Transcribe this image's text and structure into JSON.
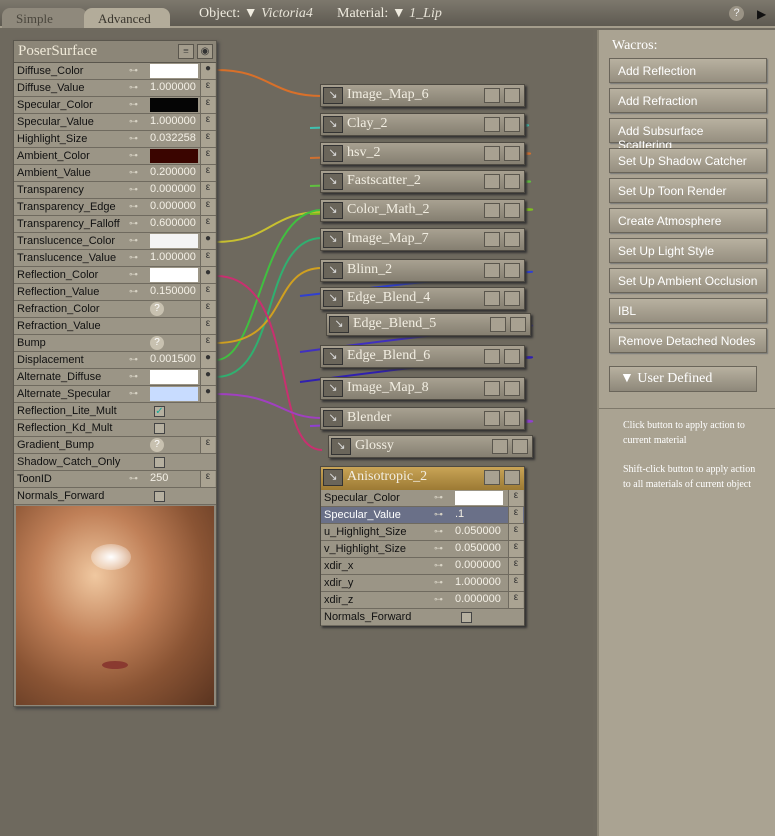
{
  "tabs": {
    "simple": "Simple",
    "advanced": "Advanced"
  },
  "object": {
    "label": "Object:",
    "value": "Victoria4"
  },
  "material": {
    "label": "Material:",
    "value": "1_Lip"
  },
  "help_icon": "?",
  "surface": {
    "title": "PoserSurface",
    "rows": [
      {
        "label": "Diffuse_Color",
        "type": "color",
        "color": "#ffffff",
        "plug": "globe"
      },
      {
        "label": "Diffuse_Value",
        "type": "value",
        "value": "1.000000"
      },
      {
        "label": "Specular_Color",
        "type": "color",
        "color": "#050505"
      },
      {
        "label": "Specular_Value",
        "type": "value",
        "value": "1.000000"
      },
      {
        "label": "Highlight_Size",
        "type": "value",
        "value": "0.032258"
      },
      {
        "label": "Ambient_Color",
        "type": "color",
        "color": "#3a0500"
      },
      {
        "label": "Ambient_Value",
        "type": "value",
        "value": "0.200000"
      },
      {
        "label": "Transparency",
        "type": "value",
        "value": "0.000000"
      },
      {
        "label": "Transparency_Edge",
        "type": "value",
        "value": "0.000000"
      },
      {
        "label": "Transparency_Falloff",
        "type": "value",
        "value": "0.600000"
      },
      {
        "label": "Translucence_Color",
        "type": "color",
        "color": "#f4f4f4",
        "plug": "globe"
      },
      {
        "label": "Translucence_Value",
        "type": "value",
        "value": "1.000000"
      },
      {
        "label": "Reflection_Color",
        "type": "color",
        "color": "#ffffff",
        "plug": "globe"
      },
      {
        "label": "Reflection_Value",
        "type": "value",
        "value": "0.150000"
      },
      {
        "label": "Refraction_Color",
        "type": "help",
        "value": "?"
      },
      {
        "label": "Refraction_Value",
        "type": "none"
      },
      {
        "label": "Bump",
        "type": "help",
        "value": "?"
      },
      {
        "label": "Displacement",
        "type": "value",
        "value": "0.001500",
        "plug": "globe"
      },
      {
        "label": "Alternate_Diffuse",
        "type": "color",
        "color": "#ffffff",
        "plug": "globe"
      },
      {
        "label": "Alternate_Specular",
        "type": "color",
        "color": "#c8dcff",
        "plug": "globe"
      },
      {
        "label": "Reflection_Lite_Mult",
        "type": "check",
        "checked": true,
        "noplug": true
      },
      {
        "label": "Reflection_Kd_Mult",
        "type": "check",
        "checked": false,
        "noplug": true
      },
      {
        "label": "Gradient_Bump",
        "type": "help",
        "value": "?"
      },
      {
        "label": "Shadow_Catch_Only",
        "type": "check",
        "checked": false,
        "noplug": true
      },
      {
        "label": "ToonID",
        "type": "value",
        "value": "250"
      },
      {
        "label": "Normals_Forward",
        "type": "check",
        "checked": false,
        "noplug": true
      }
    ]
  },
  "nodes": [
    "Image_Map_6",
    "Clay_2",
    "hsv_2",
    "Fastscatter_2",
    "Color_Math_2",
    "Image_Map_7",
    "Blinn_2",
    "Edge_Blend_4",
    "Edge_Blend_5",
    "Edge_Blend_6",
    "Image_Map_8",
    "Blender",
    "Glossy"
  ],
  "aniso": {
    "title": "Anisotropic_2",
    "rows": [
      {
        "label": "Specular_Color",
        "type": "color",
        "color": "#ffffff"
      },
      {
        "label": "Specular_Value",
        "type": "value",
        "value": ".1",
        "selected": true
      },
      {
        "label": "u_Highlight_Size",
        "type": "value",
        "value": "0.050000"
      },
      {
        "label": "v_Highlight_Size",
        "type": "value",
        "value": "0.050000"
      },
      {
        "label": "xdir_x",
        "type": "value",
        "value": "0.000000"
      },
      {
        "label": "xdir_y",
        "type": "value",
        "value": "1.000000"
      },
      {
        "label": "xdir_z",
        "type": "value",
        "value": "0.000000"
      },
      {
        "label": "Normals_Forward",
        "type": "check",
        "checked": false,
        "noplug": true
      }
    ]
  },
  "wacros": {
    "title": "Wacros:",
    "buttons": [
      "Add Reflection",
      "Add Refraction",
      "Add Subsurface Scattering",
      "Set Up Shadow Catcher",
      "Set Up Toon Render",
      "Create Atmosphere",
      "Set Up Light Style",
      "Set Up Ambient Occlusion",
      "IBL",
      "Remove Detached Nodes"
    ],
    "user_defined": "User Defined",
    "help1": "Click button to apply action to current material",
    "help2": "Shift-click button to apply action to all materials of current object"
  }
}
